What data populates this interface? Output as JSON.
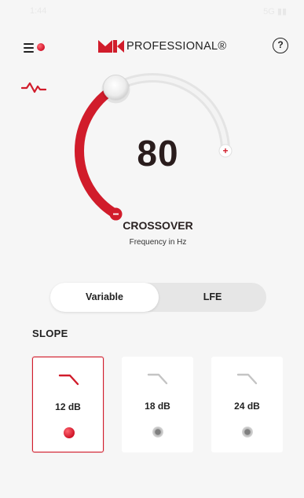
{
  "status_bar": {
    "time": "1:44",
    "right": "5G ▮▮"
  },
  "header": {
    "logo_text": "PROFESSIONAL®",
    "help_glyph": "?",
    "menu_icon": "hamburger-menu-icon",
    "help_icon": "question-circle-icon"
  },
  "dial": {
    "value": "80",
    "level_fraction": 0.5,
    "title": "CROSSOVER",
    "subtitle": "Frequency in Hz",
    "minus_glyph": "−",
    "plus_glyph": "+"
  },
  "mode_toggle": {
    "options": [
      "Variable",
      "LFE"
    ],
    "selected": "Variable"
  },
  "slope": {
    "label": "SLOPE",
    "options": [
      {
        "label": "12 dB",
        "selected": true
      },
      {
        "label": "18 dB",
        "selected": false
      },
      {
        "label": "24 dB",
        "selected": false
      }
    ]
  },
  "colors": {
    "accent": "#d11c2b",
    "track": "#e4e4e4",
    "background": "#f6f6f6",
    "inactive_icon": "#c4c4c4"
  }
}
